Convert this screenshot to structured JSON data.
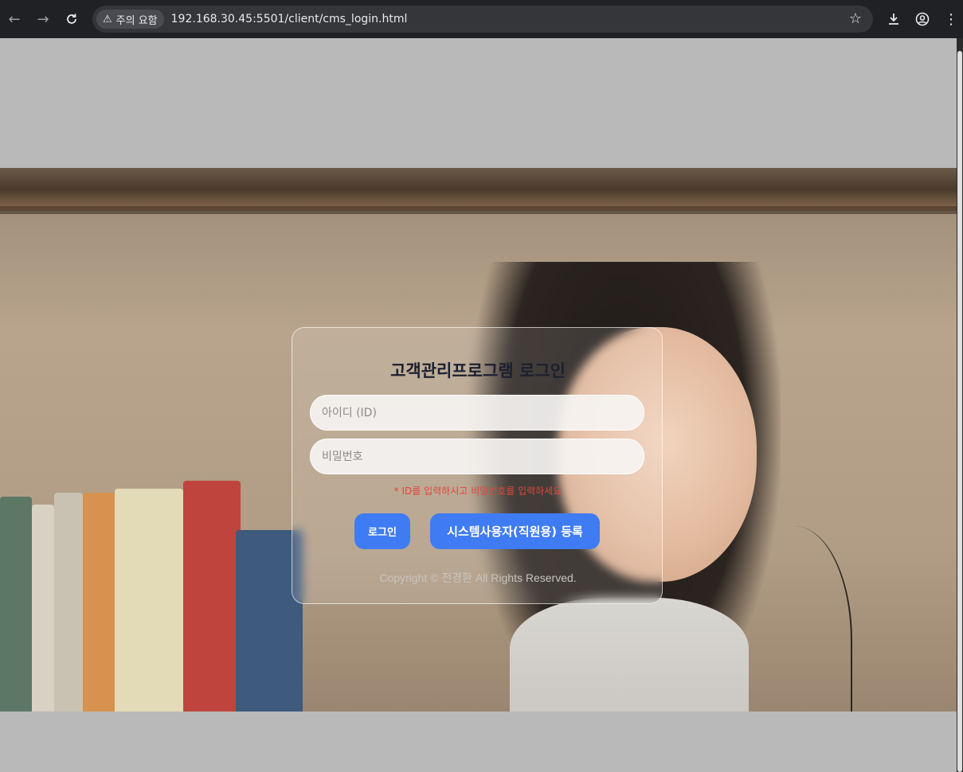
{
  "browser": {
    "security_chip": "주의 요함",
    "url": "192.168.30.45:5501/client/cms_login.html",
    "icons": [
      "back-arrow-icon",
      "forward-arrow-icon",
      "reload-icon",
      "warning-icon",
      "star-icon",
      "download-icon",
      "profile-icon",
      "menu-icon"
    ]
  },
  "login": {
    "title": "고객관리프로그램 로그인",
    "id_placeholder": "아이디 (ID)",
    "pw_placeholder": "비밀번호",
    "error_message": "* ID를 입력하시고 비밀번호를 입력하세요",
    "login_button": "로그인",
    "register_button": "시스템사용자(직원용) 등록",
    "copyright": "Copyright © 전경환 All Rights Reserved."
  },
  "colors": {
    "primary_button": "#3f7cf4",
    "error_text": "#e0463c",
    "chrome_bg": "#202124"
  }
}
